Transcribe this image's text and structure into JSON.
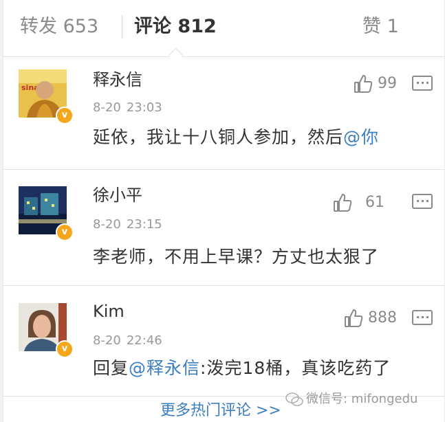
{
  "tabs": {
    "repost_label": "转发",
    "repost_count": "653",
    "comments_label": "评论",
    "comments_count": "812",
    "likes_label": "赞",
    "likes_count": "1"
  },
  "comments": [
    {
      "name": "释永信",
      "date": "8-20",
      "time": "23:03",
      "text": "延依，我让十八铜人参加，然后",
      "mention": "@你",
      "likes": "99",
      "verified_icon": "v"
    },
    {
      "name": "徐小平",
      "date": "8-20",
      "time": "23:15",
      "text": "李老师，不用上早课？方丈也太狠了",
      "likes": "61",
      "verified_icon": "v"
    },
    {
      "name": "Kim",
      "date": "8-20",
      "time": "22:46",
      "text_prefix": "回复",
      "mention": "@释永信",
      "text": ":泼完18桶，真该吃药了",
      "likes": "888",
      "verified_icon": "v"
    }
  ],
  "more_link": "更多热门评论 >>",
  "watermark": "微信号: mifongedu",
  "colors": {
    "link": "#3b7ec2",
    "verified_badge": "#f5a71b",
    "muted_text": "#999999"
  }
}
